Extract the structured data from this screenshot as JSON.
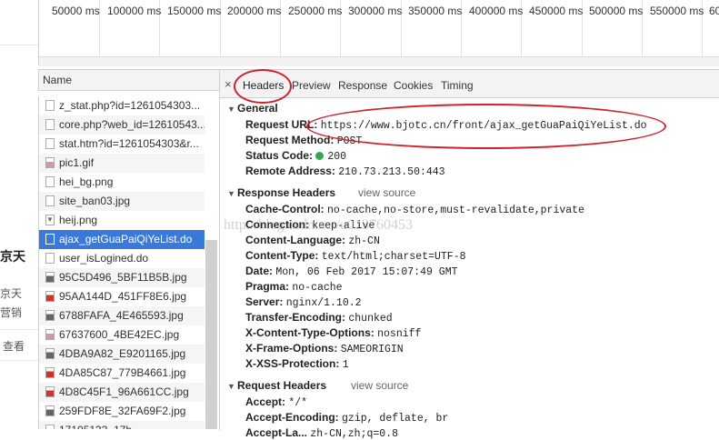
{
  "underlying_page": {
    "fragments": [
      "京天",
      "京天",
      "营销",
      "查看"
    ]
  },
  "timeline": {
    "ticks": [
      "50000 ms",
      "100000 ms",
      "150000 ms",
      "200000 ms",
      "250000 ms",
      "300000 ms",
      "350000 ms",
      "400000 ms",
      "450000 ms",
      "500000 ms",
      "550000 ms",
      "60"
    ]
  },
  "request_list": {
    "header": "Name",
    "items": [
      {
        "name": "z_stat.php?id=1261054303...",
        "icon": "script-file-icon"
      },
      {
        "name": "core.php?web_id=12610543...",
        "icon": "script-file-icon"
      },
      {
        "name": "stat.htm?id=1261054303&r...",
        "icon": "script-file-icon"
      },
      {
        "name": "pic1.gif",
        "icon": "image-file-icon"
      },
      {
        "name": "hei_bg.png",
        "icon": "image-file-icon"
      },
      {
        "name": "site_ban03.jpg",
        "icon": "image-file-icon"
      },
      {
        "name": "heij.png",
        "icon": "image-file-icon"
      },
      {
        "name": "ajax_getGuaPaiQiYeList.do",
        "icon": "document-file-icon",
        "selected": true
      },
      {
        "name": "user_isLogined.do",
        "icon": "document-file-icon"
      },
      {
        "name": "95C5D496_5BF11B5B.jpg",
        "icon": "image-file-icon"
      },
      {
        "name": "95AA144D_451FF8E6.jpg",
        "icon": "image-file-icon"
      },
      {
        "name": "6788FAFA_4E465593.jpg",
        "icon": "image-file-icon"
      },
      {
        "name": "67637600_4BE42EC.jpg",
        "icon": "image-file-icon"
      },
      {
        "name": "4DBA9A82_E9201165.jpg",
        "icon": "image-file-icon"
      },
      {
        "name": "4DA85C87_779B4661.jpg",
        "icon": "image-file-icon"
      },
      {
        "name": "4D8C45F1_96A661CC.jpg",
        "icon": "image-file-icon"
      },
      {
        "name": "259FDF8E_32FA69F2.jpg",
        "icon": "image-file-icon"
      },
      {
        "name": "17105133_17b...",
        "icon": "image-file-icon"
      }
    ]
  },
  "detail": {
    "close": "×",
    "tabs": [
      "Headers",
      "Preview",
      "Response",
      "Cookies",
      "Timing"
    ],
    "active_tab": "Headers",
    "general": {
      "title": "General",
      "rows": [
        {
          "key": "Request URL:",
          "value": "https://www.bjotc.cn/front/ajax_getGuaPaiQiYeList.do"
        },
        {
          "key": "Request Method:",
          "value": "POST"
        },
        {
          "key": "Status Code:",
          "value": "200",
          "status_color": "#32a852"
        },
        {
          "key": "Remote Address:",
          "value": "210.73.213.50:443"
        }
      ]
    },
    "response_headers": {
      "title": "Response Headers",
      "view_source": "view source",
      "rows": [
        {
          "key": "Cache-Control:",
          "value": "no-cache,no-store,must-revalidate,private"
        },
        {
          "key": "Connection:",
          "value": "keep-alive"
        },
        {
          "key": "Content-Language:",
          "value": "zh-CN"
        },
        {
          "key": "Content-Type:",
          "value": "text/html;charset=UTF-8"
        },
        {
          "key": "Date:",
          "value": "Mon, 06 Feb 2017 15:07:49 GMT"
        },
        {
          "key": "Pragma:",
          "value": "no-cache"
        },
        {
          "key": "Server:",
          "value": "nginx/1.10.2"
        },
        {
          "key": "Transfer-Encoding:",
          "value": "chunked"
        },
        {
          "key": "X-Content-Type-Options:",
          "value": "nosniff"
        },
        {
          "key": "X-Frame-Options:",
          "value": "SAMEORIGIN"
        },
        {
          "key": "X-XSS-Protection:",
          "value": "1"
        }
      ]
    },
    "request_headers": {
      "title": "Request Headers",
      "view_source": "view source",
      "rows": [
        {
          "key": "Accept:",
          "value": "*/*"
        },
        {
          "key": "Accept-Encoding:",
          "value": "gzip, deflate, br"
        },
        {
          "key": "Accept-La...",
          "value": "zh-CN,zh;q=0.8"
        }
      ]
    }
  },
  "watermark": "http://blog.csdn.net/u013760453",
  "colors": {
    "selection": "#3879d9",
    "annotation": "#d0202a",
    "status_ok": "#32a852"
  }
}
